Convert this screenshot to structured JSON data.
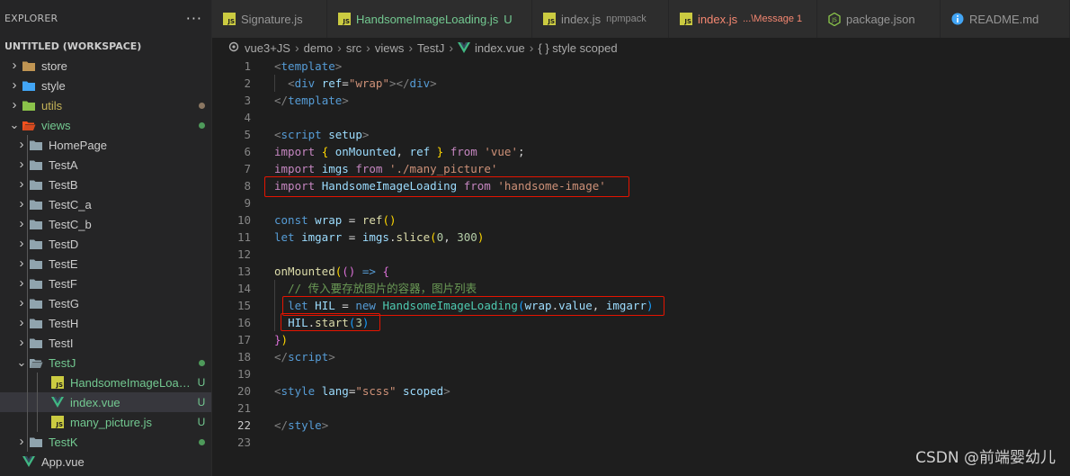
{
  "sidebar": {
    "title": "EXPLORER",
    "more_icon": "ellipsis-icon",
    "workspace": "UNTITLED (WORKSPACE)",
    "items": [
      {
        "label": "store",
        "type": "folder",
        "color": "#c09553",
        "depth": 1,
        "open": false,
        "decoration": ""
      },
      {
        "label": "style",
        "type": "folder",
        "color": "#42a5f5",
        "depth": 1,
        "open": false,
        "decoration": ""
      },
      {
        "label": "utils",
        "type": "folder",
        "color": "#8bc34a",
        "depth": 1,
        "open": false,
        "decoration": "dot",
        "dot_color": "#8b7762",
        "label_color": "#c5b358"
      },
      {
        "label": "views",
        "type": "folder",
        "color": "#f4511e",
        "depth": 1,
        "open": true,
        "decoration": "dot",
        "dot_color": "#4e9a5a",
        "label_color": "#73c991"
      },
      {
        "label": "HomePage",
        "type": "folder",
        "color": "#90a4ae",
        "depth": 2,
        "open": false,
        "decoration": ""
      },
      {
        "label": "TestA",
        "type": "folder",
        "color": "#90a4ae",
        "depth": 2,
        "open": false,
        "decoration": ""
      },
      {
        "label": "TestB",
        "type": "folder",
        "color": "#90a4ae",
        "depth": 2,
        "open": false,
        "decoration": ""
      },
      {
        "label": "TestC_a",
        "type": "folder",
        "color": "#90a4ae",
        "depth": 2,
        "open": false,
        "decoration": ""
      },
      {
        "label": "TestC_b",
        "type": "folder",
        "color": "#90a4ae",
        "depth": 2,
        "open": false,
        "decoration": ""
      },
      {
        "label": "TestD",
        "type": "folder",
        "color": "#90a4ae",
        "depth": 2,
        "open": false,
        "decoration": ""
      },
      {
        "label": "TestE",
        "type": "folder",
        "color": "#90a4ae",
        "depth": 2,
        "open": false,
        "decoration": ""
      },
      {
        "label": "TestF",
        "type": "folder",
        "color": "#90a4ae",
        "depth": 2,
        "open": false,
        "decoration": ""
      },
      {
        "label": "TestG",
        "type": "folder",
        "color": "#90a4ae",
        "depth": 2,
        "open": false,
        "decoration": ""
      },
      {
        "label": "TestH",
        "type": "folder",
        "color": "#90a4ae",
        "depth": 2,
        "open": false,
        "decoration": ""
      },
      {
        "label": "TestI",
        "type": "folder",
        "color": "#90a4ae",
        "depth": 2,
        "open": false,
        "decoration": ""
      },
      {
        "label": "TestJ",
        "type": "folder",
        "color": "#90a4ae",
        "depth": 2,
        "open": true,
        "decoration": "dot",
        "dot_color": "#4e9a5a",
        "label_color": "#73c991"
      },
      {
        "label": "HandsomeImageLoading.js",
        "type": "js",
        "depth": 3,
        "decoration": "U",
        "label_color": "#73c991"
      },
      {
        "label": "index.vue",
        "type": "vue",
        "depth": 3,
        "decoration": "U",
        "label_color": "#73c991",
        "selected": true
      },
      {
        "label": "many_picture.js",
        "type": "js",
        "depth": 3,
        "decoration": "U",
        "label_color": "#73c991"
      },
      {
        "label": "TestK",
        "type": "folder",
        "color": "#90a4ae",
        "depth": 2,
        "open": false,
        "decoration": "dot",
        "dot_color": "#4e9a5a",
        "label_color": "#73c991"
      },
      {
        "label": "App.vue",
        "type": "vue",
        "depth": 1,
        "decoration": ""
      }
    ]
  },
  "tabs": [
    {
      "label": "Signature.js",
      "icon": "js-icon",
      "desc": "",
      "state": "normal"
    },
    {
      "label": "HandsomeImageLoading.js",
      "icon": "js-icon",
      "desc": "U",
      "state": "modified"
    },
    {
      "label": "index.js",
      "icon": "js-icon",
      "desc": "npmpack",
      "state": "normal"
    },
    {
      "label": "index.js",
      "icon": "js-icon",
      "desc": "...\\Message 1",
      "state": "error"
    },
    {
      "label": "package.json",
      "icon": "nodejs-icon",
      "desc": "",
      "state": "normal"
    },
    {
      "label": "README.md",
      "icon": "info-icon",
      "desc": "",
      "state": "normal"
    }
  ],
  "breadcrumb": [
    "vue3+JS",
    "demo",
    "src",
    "views",
    "TestJ",
    "index.vue",
    "{ } style scoped"
  ],
  "editor": {
    "active_line": 22,
    "lines": [
      [
        [
          "t-tag",
          "<"
        ],
        [
          "t-tagname",
          "template"
        ],
        [
          "t-tag",
          ">"
        ]
      ],
      [
        [
          "t-plain",
          "  "
        ],
        [
          "t-tag",
          "<"
        ],
        [
          "t-tagname",
          "div"
        ],
        [
          "t-plain",
          " "
        ],
        [
          "t-attr",
          "ref"
        ],
        [
          "t-plain",
          "="
        ],
        [
          "t-str",
          "\"wrap\""
        ],
        [
          "t-tag",
          "></"
        ],
        [
          "t-tagname",
          "div"
        ],
        [
          "t-tag",
          ">"
        ]
      ],
      [
        [
          "t-tag",
          "</"
        ],
        [
          "t-tagname",
          "template"
        ],
        [
          "t-tag",
          ">"
        ]
      ],
      [],
      [
        [
          "t-tag",
          "<"
        ],
        [
          "t-tagname",
          "script"
        ],
        [
          "t-plain",
          " "
        ],
        [
          "t-attr",
          "setup"
        ],
        [
          "t-tag",
          ">"
        ]
      ],
      [
        [
          "t-kw",
          "import"
        ],
        [
          "t-plain",
          " "
        ],
        [
          "t-br1",
          "{"
        ],
        [
          "t-plain",
          " "
        ],
        [
          "t-var",
          "onMounted"
        ],
        [
          "t-plain",
          ", "
        ],
        [
          "t-var",
          "ref"
        ],
        [
          "t-plain",
          " "
        ],
        [
          "t-br1",
          "}"
        ],
        [
          "t-plain",
          " "
        ],
        [
          "t-kw",
          "from"
        ],
        [
          "t-plain",
          " "
        ],
        [
          "t-str",
          "'vue'"
        ],
        [
          "t-plain",
          ";"
        ]
      ],
      [
        [
          "t-kw",
          "import"
        ],
        [
          "t-plain",
          " "
        ],
        [
          "t-var",
          "imgs"
        ],
        [
          "t-plain",
          " "
        ],
        [
          "t-kw",
          "from"
        ],
        [
          "t-plain",
          " "
        ],
        [
          "t-str",
          "'./many_picture'"
        ]
      ],
      [
        [
          "t-kw",
          "import"
        ],
        [
          "t-plain",
          " "
        ],
        [
          "t-var",
          "HandsomeImageLoading"
        ],
        [
          "t-plain",
          " "
        ],
        [
          "t-kw",
          "from"
        ],
        [
          "t-plain",
          " "
        ],
        [
          "t-str",
          "'handsome-image'"
        ]
      ],
      [],
      [
        [
          "t-blue",
          "const"
        ],
        [
          "t-plain",
          " "
        ],
        [
          "t-var",
          "wrap"
        ],
        [
          "t-plain",
          " = "
        ],
        [
          "t-fn",
          "ref"
        ],
        [
          "t-br1",
          "()"
        ]
      ],
      [
        [
          "t-blue",
          "let"
        ],
        [
          "t-plain",
          " "
        ],
        [
          "t-var",
          "imgarr"
        ],
        [
          "t-plain",
          " = "
        ],
        [
          "t-var",
          "imgs"
        ],
        [
          "t-plain",
          "."
        ],
        [
          "t-fn",
          "slice"
        ],
        [
          "t-br1",
          "("
        ],
        [
          "t-num",
          "0"
        ],
        [
          "t-plain",
          ", "
        ],
        [
          "t-num",
          "300"
        ],
        [
          "t-br1",
          ")"
        ]
      ],
      [],
      [
        [
          "t-fn",
          "onMounted"
        ],
        [
          "t-br1",
          "("
        ],
        [
          "t-br2",
          "()"
        ],
        [
          "t-plain",
          " "
        ],
        [
          "t-blue",
          "=>"
        ],
        [
          "t-plain",
          " "
        ],
        [
          "t-br2",
          "{"
        ]
      ],
      [
        [
          "t-plain",
          "  "
        ],
        [
          "t-com",
          "// 传入要存放图片的容器，图片列表"
        ]
      ],
      [
        [
          "t-plain",
          "  "
        ],
        [
          "t-blue",
          "let"
        ],
        [
          "t-plain",
          " "
        ],
        [
          "t-var",
          "HIL"
        ],
        [
          "t-plain",
          " = "
        ],
        [
          "t-blue",
          "new"
        ],
        [
          "t-plain",
          " "
        ],
        [
          "t-cls",
          "HandsomeImageLoading"
        ],
        [
          "t-br3",
          "("
        ],
        [
          "t-var",
          "wrap"
        ],
        [
          "t-plain",
          "."
        ],
        [
          "t-var",
          "value"
        ],
        [
          "t-plain",
          ", "
        ],
        [
          "t-var",
          "imgarr"
        ],
        [
          "t-br3",
          ")"
        ]
      ],
      [
        [
          "t-plain",
          "  "
        ],
        [
          "t-var",
          "HIL"
        ],
        [
          "t-plain",
          "."
        ],
        [
          "t-fn",
          "start"
        ],
        [
          "t-br3",
          "("
        ],
        [
          "t-num",
          "3"
        ],
        [
          "t-br3",
          ")"
        ]
      ],
      [
        [
          "t-br2",
          "}"
        ],
        [
          "t-br1",
          ")"
        ]
      ],
      [
        [
          "t-tag",
          "</"
        ],
        [
          "t-tagname",
          "script"
        ],
        [
          "t-tag",
          ">"
        ]
      ],
      [],
      [
        [
          "t-tag",
          "<"
        ],
        [
          "t-tagname",
          "style"
        ],
        [
          "t-plain",
          " "
        ],
        [
          "t-attr",
          "lang"
        ],
        [
          "t-plain",
          "="
        ],
        [
          "t-str",
          "\"scss\""
        ],
        [
          "t-plain",
          " "
        ],
        [
          "t-attr",
          "scoped"
        ],
        [
          "t-tag",
          ">"
        ]
      ],
      [],
      [
        [
          "t-tag",
          "</"
        ],
        [
          "t-tagname",
          "style"
        ],
        [
          "t-tag",
          ">"
        ]
      ],
      []
    ]
  },
  "watermark": "CSDN @前端婴幼儿",
  "colors": {
    "highlight_box": "#e51400",
    "untracked": "#73c991",
    "error": "#f48771"
  }
}
